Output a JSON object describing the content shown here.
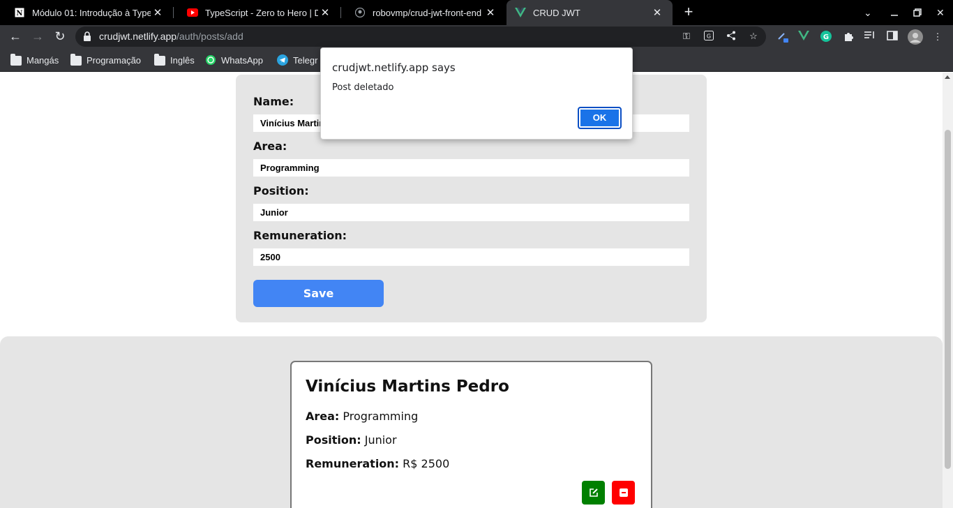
{
  "browser": {
    "tabs": [
      {
        "title": "Módulo 01: Introdução à Type",
        "icon": "notion-icon"
      },
      {
        "title": "TypeScript - Zero to Hero | De",
        "icon": "youtube-icon"
      },
      {
        "title": "robovmp/crud-jwt-front-end",
        "icon": "github-icon"
      },
      {
        "title": "CRUD JWT",
        "icon": "vue-icon",
        "active": true
      }
    ],
    "url_host": "crudjwt.netlify.app",
    "url_path": "/auth/posts/add",
    "bookmarks": [
      {
        "label": "Mangás",
        "icon": "folder-icon"
      },
      {
        "label": "Programação",
        "icon": "folder-icon"
      },
      {
        "label": "Inglês",
        "icon": "folder-icon"
      },
      {
        "label": "WhatsApp",
        "icon": "whatsapp-icon"
      },
      {
        "label": "Telegr",
        "icon": "telegram-icon"
      }
    ]
  },
  "form": {
    "name_label": "Name:",
    "name_value": "Vinícius Martins Pedro",
    "area_label": "Area:",
    "area_value": "Programming",
    "position_label": "Position:",
    "position_value": "Junior",
    "remuneration_label": "Remuneration:",
    "remuneration_value": "2500",
    "save_label": "Save"
  },
  "post": {
    "title": "Vinícius Martins Pedro",
    "area_label": "Area:",
    "area_value": "Programming",
    "position_label": "Position:",
    "position_value": "Junior",
    "remuneration_label": "Remuneration:",
    "remuneration_value": "R$ 2500"
  },
  "dialog": {
    "title": "crudjwt.netlify.app says",
    "message": "Post deletado",
    "ok_label": "OK"
  },
  "colors": {
    "save_button": "#4285f4",
    "edit_button": "#008000",
    "delete_button": "#ff0000",
    "dialog_ok": "#1a73e8"
  }
}
